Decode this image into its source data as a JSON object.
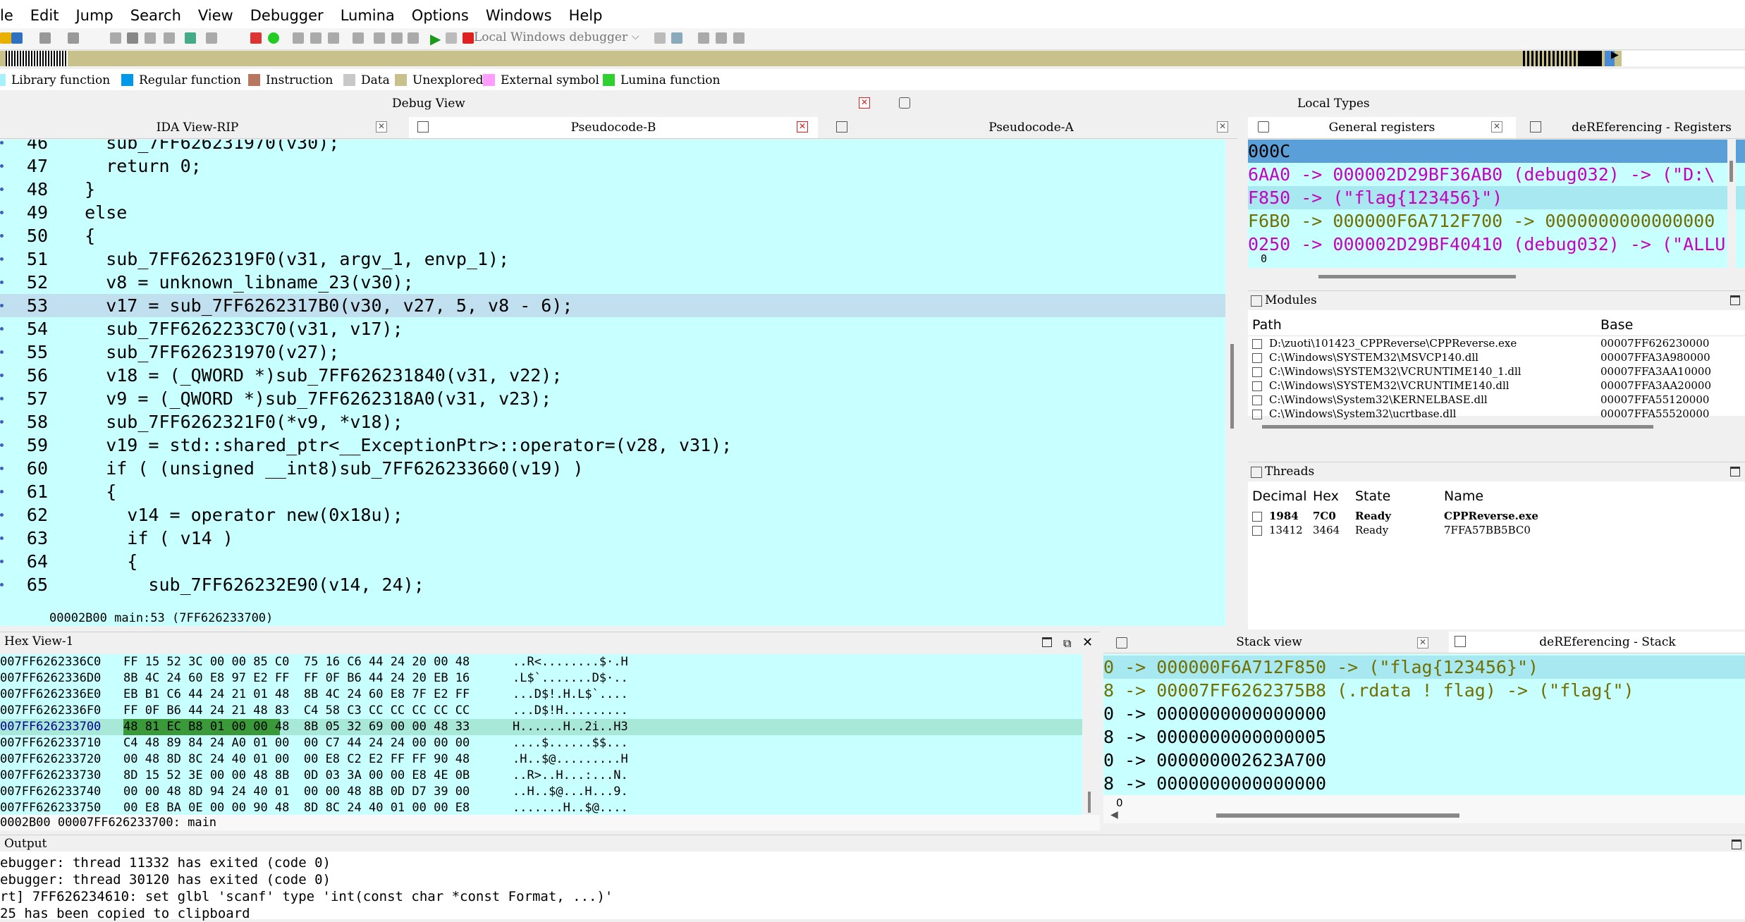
{
  "menu": [
    "le",
    "Edit",
    "Jump",
    "Search",
    "View",
    "Debugger",
    "Lumina",
    "Options",
    "Windows",
    "Help"
  ],
  "toolbar": {
    "debugger_select": "Local Windows debugger"
  },
  "legend": [
    {
      "label": "Library function",
      "color": "#a8f0ff"
    },
    {
      "label": "Regular function",
      "color": "#0098e8"
    },
    {
      "label": "Instruction",
      "color": "#b87860"
    },
    {
      "label": "Data",
      "color": "#c8c8c8"
    },
    {
      "label": "Unexplored",
      "color": "#c8c18c"
    },
    {
      "label": "External symbol",
      "color": "#ff9cff"
    },
    {
      "label": "Lumina function",
      "color": "#30d030"
    }
  ],
  "panels": {
    "debug_view": "Debug View",
    "local_types": "Local Types",
    "modules": "Modules",
    "threads": "Threads",
    "output": "Output",
    "hex_view": "Hex View-1"
  },
  "tabs": {
    "ida_view": "IDA View-RIP",
    "pseudocode_b": "Pseudocode-B",
    "pseudocode_a": "Pseudocode-A",
    "general_registers": "General registers",
    "deref_registers": "deREferencing - Registers",
    "stack_view": "Stack view",
    "deref_stack": "deREferencing - Stack"
  },
  "code": {
    "lines": [
      {
        "n": "46",
        "t": "    sub_7FF626231970(v30);"
      },
      {
        "n": "47",
        "t": "    return 0;"
      },
      {
        "n": "48",
        "t": "  }"
      },
      {
        "n": "49",
        "t": "  else"
      },
      {
        "n": "50",
        "t": "  {"
      },
      {
        "n": "51",
        "t": "    sub_7FF6262319F0(v31, argv_1, envp_1);"
      },
      {
        "n": "52",
        "t": "    v8 = unknown_libname_23(v30);"
      },
      {
        "n": "53",
        "t": "    v17 = sub_7FF6262317B0(v30, v27, 5, v8 - 6);"
      },
      {
        "n": "54",
        "t": "    sub_7FF6262233C70(v31, v17);"
      },
      {
        "n": "55",
        "t": "    sub_7FF626231970(v27);"
      },
      {
        "n": "56",
        "t": "    v18 = (_QWORD *)sub_7FF626231840(v31, v22);"
      },
      {
        "n": "57",
        "t": "    v9 = (_QWORD *)sub_7FF6262318A0(v31, v23);"
      },
      {
        "n": "58",
        "t": "    sub_7FF6262321F0(*v9, *v18);"
      },
      {
        "n": "59",
        "t": "    v19 = std::shared_ptr<__ExceptionPtr>::operator=(v28, v31);"
      },
      {
        "n": "60",
        "t": "    if ( (unsigned __int8)sub_7FF626233660(v19) )"
      },
      {
        "n": "61",
        "t": "    {"
      },
      {
        "n": "62",
        "t": "      v14 = operator new(0x18u);"
      },
      {
        "n": "63",
        "t": "      if ( v14 )"
      },
      {
        "n": "64",
        "t": "      {"
      },
      {
        "n": "65",
        "t": "        sub_7FF626232E90(v14, 24);"
      }
    ],
    "status": "00002B00 main:53 (7FF626233700)"
  },
  "registers": [
    "000C",
    "6AA0 -> 000002D29BF36AB0 (debug032) -> (\"D:\\",
    "F850 -> (\"flag{123456}\")",
    "F6B0 -> 000000F6A712F700 -> 0000000000000000",
    "0250 -> 000002D29BF40410 (debug032) -> (\"ALLU"
  ],
  "registers_footer": "0",
  "modules": {
    "headers": [
      "Path",
      "Base"
    ],
    "rows": [
      [
        "D:\\zuoti\\101423_CPPReverse\\CPPReverse.exe",
        "00007FF626230000"
      ],
      [
        "C:\\Windows\\SYSTEM32\\MSVCP140.dll",
        "00007FFA3A980000"
      ],
      [
        "C:\\Windows\\SYSTEM32\\VCRUNTIME140_1.dll",
        "00007FFA3AA10000"
      ],
      [
        "C:\\Windows\\SYSTEM32\\VCRUNTIME140.dll",
        "00007FFA3AA20000"
      ],
      [
        "C:\\Windows\\System32\\KERNELBASE.dll",
        "00007FFA55120000"
      ],
      [
        "C:\\Windows\\System32\\ucrtbase.dll",
        "00007FFA55520000"
      ]
    ]
  },
  "threads": {
    "headers": [
      "Decimal",
      "Hex",
      "State",
      "Name"
    ],
    "rows": [
      [
        "1984",
        "7C0",
        "Ready",
        "CPPReverse.exe"
      ],
      [
        "13412",
        "3464",
        "Ready",
        "7FFA57BB5BC0"
      ]
    ]
  },
  "hex": {
    "rows": [
      [
        "007FF6262336C0",
        "FF 15 52 3C 00 00 85 C0  75 16 C6 44 24 20 00 48",
        "..R<........$·.H"
      ],
      [
        "007FF6262336D0",
        "8B 4C 24 60 E8 97 E2 FF  FF 0F B6 44 24 20 EB 16",
        ".L$`.......D$·.."
      ],
      [
        "007FF6262336E0",
        "EB B1 C6 44 24 21 01 48  8B 4C 24 60 E8 7F E2 FF",
        "...D$!.H.L$`...."
      ],
      [
        "007FF6262336F0",
        "FF 0F B6 44 24 21 48 83  C4 58 C3 CC CC CC CC CC",
        "...D$!H........."
      ],
      [
        "007FF626233700",
        "48 81 EC B8 01 00 00 48  8B 05 32 69 00 00 48 33",
        "H......H..2i..H3"
      ],
      [
        "007FF626233710",
        "C4 48 89 84 24 A0 01 00  00 C7 44 24 24 00 00 00",
        "....$......$$..."
      ],
      [
        "007FF626233720",
        "00 48 8D 8C 24 40 01 00  00 E8 C2 E2 FF FF 90 48",
        ".H..$@.........H"
      ],
      [
        "007FF626233730",
        "8D 15 52 3E 00 00 48 8B  0D 03 3A 00 00 E8 4E 0B",
        "..R>..H...:...N."
      ],
      [
        "007FF626233740",
        "00 00 48 8D 94 24 40 01  00 00 48 8B 0D D7 39 00",
        "..H..$@...H...9."
      ],
      [
        "007FF626233750",
        "00 E8 BA 0E 00 00 90 48  8D 8C 24 40 01 00 00 E8",
        ".......H..$@...."
      ]
    ],
    "status": "0002B00 00007FF626233700: main"
  },
  "stack": [
    "0 -> 000000F6A712F850 -> (\"flag{123456}\")",
    "8 -> 00007FF6262375B8 (.rdata ! flag) -> (\"flag{\")",
    "0 -> 0000000000000000",
    "8 -> 0000000000000005",
    "0 -> 000000002623A700",
    "8 -> 0000000000000000"
  ],
  "stack_footer": "0",
  "output": [
    "ebugger: thread 11332 has exited (code 0)",
    "ebugger: thread 30120 has exited (code 0)",
    "rt] 7FF626234610: set glbl 'scanf' type 'int(const char *const Format, ...)'",
    "25 has been copied to clipboard"
  ]
}
